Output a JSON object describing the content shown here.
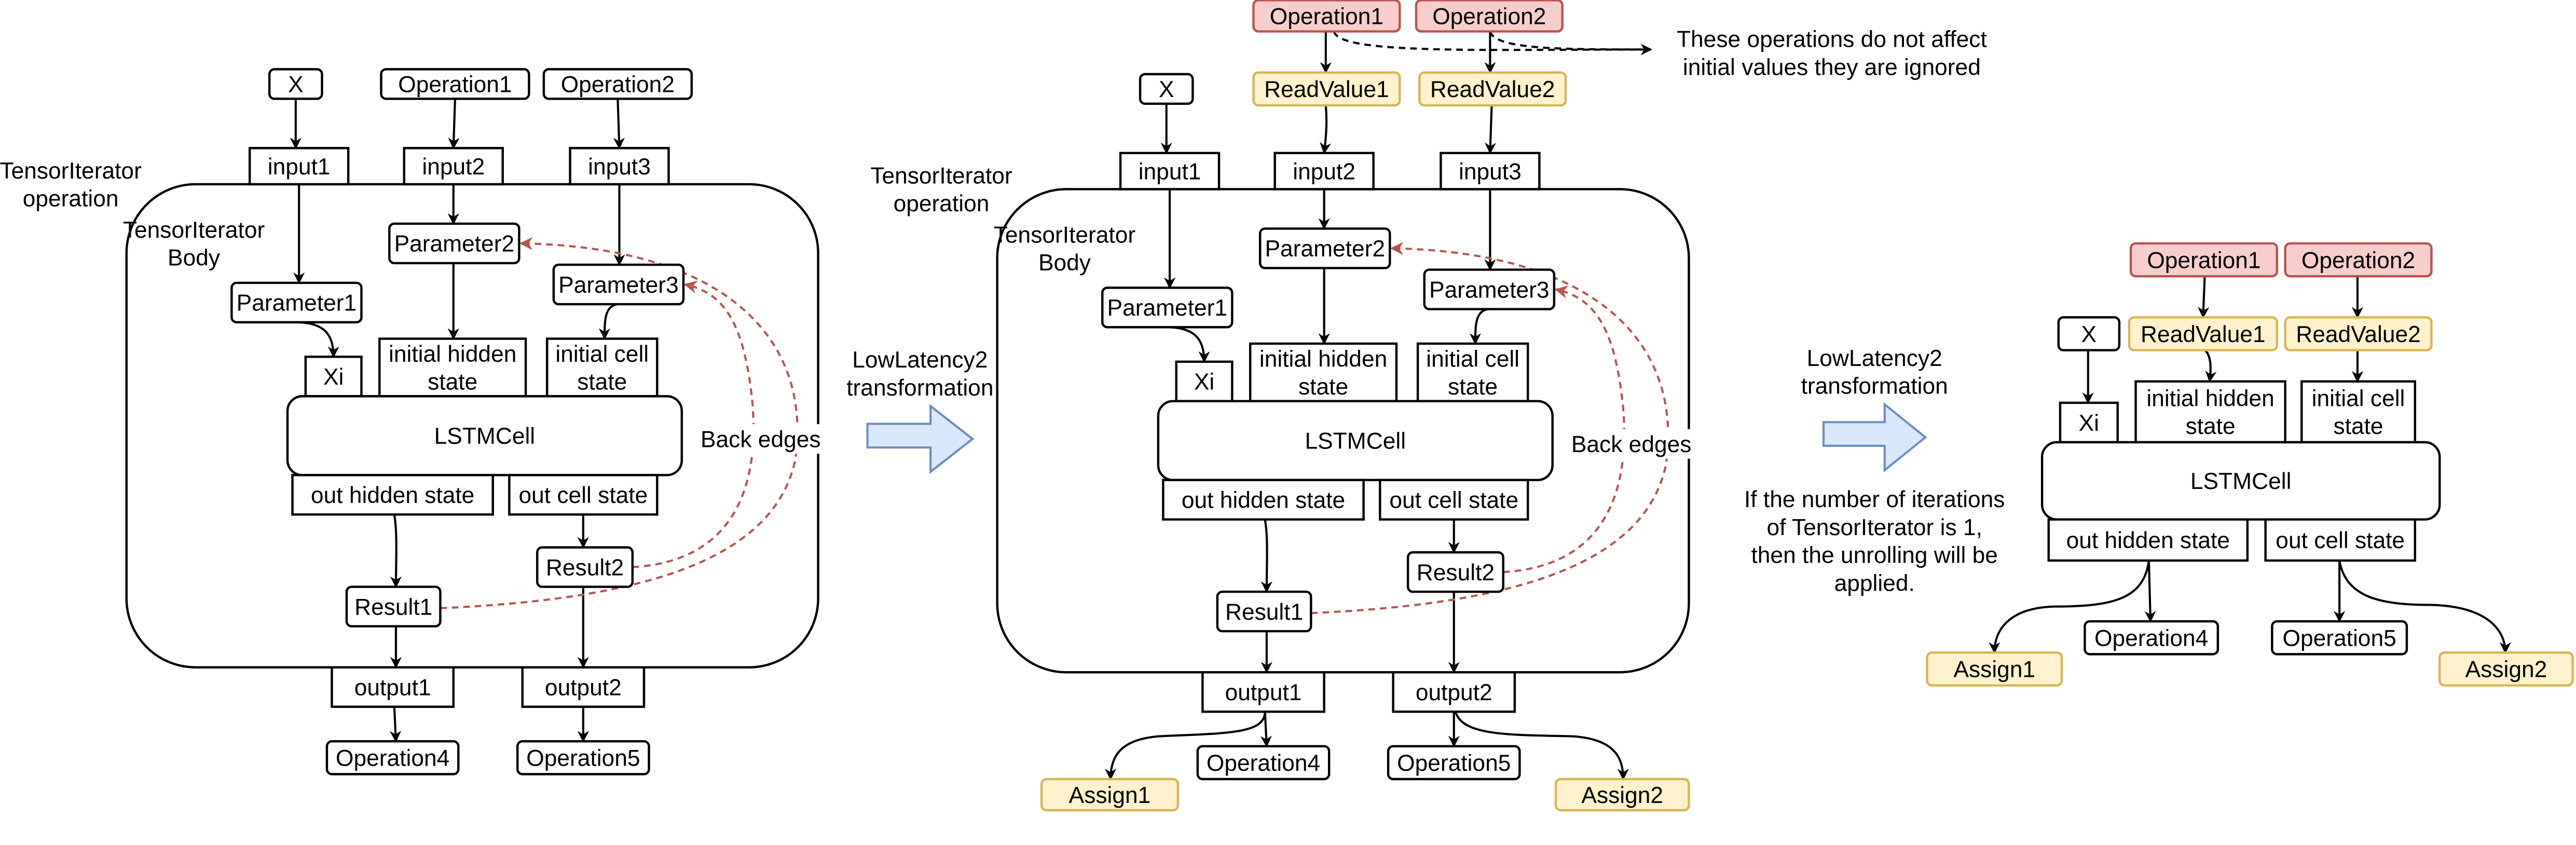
{
  "left": {
    "op_label": [
      "TensorIterator",
      "operation"
    ],
    "body_label": [
      "TensorIterator",
      "Body"
    ],
    "back_edges": "Back edges",
    "nodes": {
      "x": "X",
      "op1": "Operation1",
      "op2": "Operation2",
      "input1": "input1",
      "input2": "input2",
      "input3": "input3",
      "param1": "Parameter1",
      "param2": "Parameter2",
      "param3": "Parameter3",
      "xi": "Xi",
      "init_hidden": [
        "initial hidden",
        "state"
      ],
      "init_cell": [
        "initial cell",
        "state"
      ],
      "lstm": "LSTMCell",
      "out_hidden": "out hidden state",
      "out_cell": "out cell state",
      "result1": "Result1",
      "result2": "Result2",
      "output1": "output1",
      "output2": "output2",
      "op4": "Operation4",
      "op5": "Operation5"
    }
  },
  "middle": {
    "op_label": [
      "TensorIterator",
      "operation"
    ],
    "body_label": [
      "TensorIterator",
      "Body"
    ],
    "back_edges": "Back edges",
    "note": [
      "These operations do not affect",
      "initial values they are ignored"
    ],
    "nodes": {
      "x": "X",
      "op1": "Operation1",
      "op2": "Operation2",
      "readvalue1": "ReadValue1",
      "readvalue2": "ReadValue2",
      "input1": "input1",
      "input2": "input2",
      "input3": "input3",
      "param1": "Parameter1",
      "param2": "Parameter2",
      "param3": "Parameter3",
      "xi": "Xi",
      "init_hidden": [
        "initial hidden",
        "state"
      ],
      "init_cell": [
        "initial cell",
        "state"
      ],
      "lstm": "LSTMCell",
      "out_hidden": "out hidden state",
      "out_cell": "out cell state",
      "result1": "Result1",
      "result2": "Result2",
      "output1": "output1",
      "output2": "output2",
      "op4": "Operation4",
      "op5": "Operation5",
      "assign1": "Assign1",
      "assign2": "Assign2"
    }
  },
  "transforms": [
    {
      "label": [
        "LowLatency2",
        "transformation"
      ],
      "icon": "right-arrow-icon"
    },
    {
      "label": [
        "LowLatency2",
        "transformation"
      ],
      "icon": "right-arrow-icon",
      "note": [
        "If the number of iterations",
        "of TensorIterator is 1,",
        "then the unrolling will be",
        "applied."
      ]
    }
  ],
  "right": {
    "nodes": {
      "op1": "Operation1",
      "op2": "Operation2",
      "x": "X",
      "readvalue1": "ReadValue1",
      "readvalue2": "ReadValue2",
      "xi": "Xi",
      "init_hidden": [
        "initial hidden",
        "state"
      ],
      "init_cell": [
        "initial cell",
        "state"
      ],
      "lstm": "LSTMCell",
      "out_hidden": "out hidden state",
      "out_cell": "out cell state",
      "op4": "Operation4",
      "op5": "Operation5",
      "assign1": "Assign1",
      "assign2": "Assign2"
    }
  },
  "colors": {
    "ignored_op_fill": "#f8cecc",
    "ignored_op_stroke": "#b85450",
    "state_fill": "#fff2cc",
    "state_stroke": "#d6b656",
    "arrow_fill": "#dae8fc",
    "arrow_stroke": "#6c8ebf",
    "back_edge": "#b85450"
  }
}
